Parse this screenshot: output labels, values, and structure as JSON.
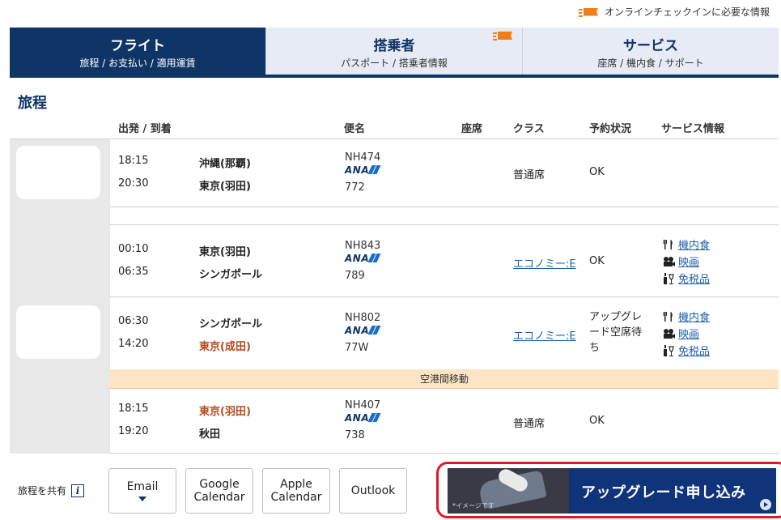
{
  "checkin_info": "オンラインチェックインに必要な情報",
  "tabs": [
    {
      "title": "フライト",
      "sub": "旅程 / お支払い / 適用運賃"
    },
    {
      "title": "搭乗者",
      "sub": "パスポート / 搭乗者情報"
    },
    {
      "title": "サービス",
      "sub": "座席 / 機内食 / サポート"
    }
  ],
  "section_title": "旅程",
  "headers": {
    "dep_arr": "出発 / 到着",
    "flight": "便名",
    "seat": "座席",
    "class": "クラス",
    "status": "予約状況",
    "service": "サービス情報"
  },
  "airline_logo": "ANA",
  "segments": [
    {
      "dep_time": "18:15",
      "dep_city": "沖縄(那覇)",
      "arr_time": "20:30",
      "arr_city": "東京(羽田)",
      "flight": "NH474",
      "aircraft": "772",
      "class": "普通席",
      "status": "OK"
    },
    {
      "dep_time": "00:10",
      "dep_city": "東京(羽田)",
      "arr_time": "06:35",
      "arr_city": "シンガポール",
      "flight": "NH843",
      "aircraft": "789",
      "class": "エコノミー:E",
      "status": "OK",
      "services": [
        "機内食",
        "映画",
        "免税品"
      ]
    },
    {
      "dep_time": "06:30",
      "dep_city": "シンガポール",
      "arr_time": "14:20",
      "arr_city": "東京(成田)",
      "flight": "NH802",
      "aircraft": "77W",
      "class": "エコノミー:E",
      "status": "アップグレード空席待ち",
      "services": [
        "機内食",
        "映画",
        "免税品"
      ]
    },
    {
      "dep_time": "18:15",
      "dep_city": "東京(羽田)",
      "arr_time": "19:20",
      "arr_city": "秋田",
      "flight": "NH407",
      "aircraft": "738",
      "class": "普通席",
      "status": "OK"
    }
  ],
  "transfer_label": "空港間移動",
  "share": {
    "label": "旅程を共有",
    "info_icon": "i",
    "email": "Email",
    "google_line1": "Google",
    "google_line2": "Calendar",
    "apple_line1": "Apple",
    "apple_line2": "Calendar",
    "outlook": "Outlook"
  },
  "banner": {
    "text": "アップグレード申し込み",
    "note": "*イメージです"
  },
  "colors": {
    "brand_navy": "#0f3466",
    "link_blue": "#1f5fa8",
    "warning_orange": "#b8471b",
    "transfer_bg": "#fce4c4",
    "highlight_red": "#d91c2a"
  }
}
